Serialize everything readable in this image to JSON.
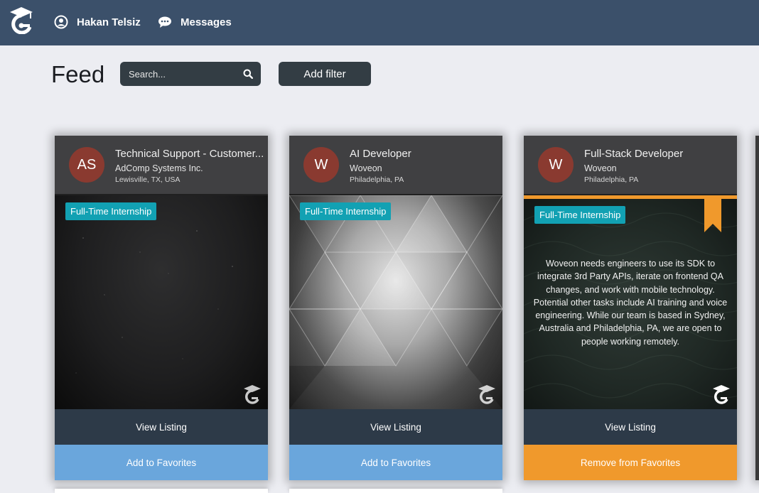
{
  "nav": {
    "logo_icon": "graduation-cap-logo-icon",
    "user_icon": "user-circle-icon",
    "user_name": "Hakan Telsiz",
    "messages_icon": "chat-bubble-icon",
    "messages_label": "Messages"
  },
  "header": {
    "title": "Feed",
    "search_placeholder": "Search...",
    "search_icon": "search-icon",
    "add_filter_label": "Add filter"
  },
  "colors": {
    "nav_bg": "#3b506a",
    "page_bg": "#ecedf2",
    "tag_bg": "#12a1b3",
    "view_btn_bg": "#2d3a48",
    "favorite_add_bg": "#6aa6dc",
    "favorite_remove_bg": "#f0992c",
    "avatar_bg": "#8a3a30"
  },
  "cards": [
    {
      "avatar_text": "AS",
      "title": "Technical Support - Customer...",
      "company": "AdComp Systems Inc.",
      "location": "Lewisville, TX, USA",
      "tag": "Full-Time Internship",
      "description": "",
      "view_label": "View Listing",
      "favorite_label": "Add to Favorites",
      "favorited": false
    },
    {
      "avatar_text": "W",
      "title": "AI Developer",
      "company": "Woveon",
      "location": "Philadelphia, PA",
      "tag": "Full-Time Internship",
      "description": "",
      "view_label": "View Listing",
      "favorite_label": "Add to Favorites",
      "favorited": false
    },
    {
      "avatar_text": "W",
      "title": "Full-Stack Developer",
      "company": "Woveon",
      "location": "Philadelphia, PA",
      "tag": "Full-Time Internship",
      "description": "Woveon needs engineers to use its SDK to integrate 3rd Party APIs, iterate on frontend QA changes, and work with mobile technology. Potential other tasks include AI training and voice engineering. While our team is based in Sydney, Australia and Philadelphia, PA, we are open to people working remotely.",
      "view_label": "View Listing",
      "favorite_label": "Remove from Favorites",
      "favorited": true
    }
  ]
}
